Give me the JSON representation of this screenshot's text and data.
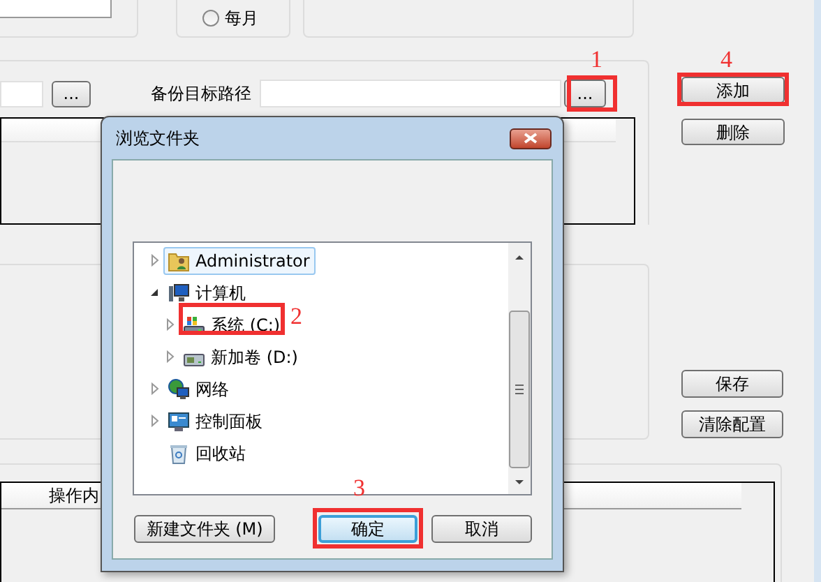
{
  "background": {
    "frequency_option": {
      "label": "每月",
      "selected": false
    },
    "source_browse_button": "...",
    "target_path": {
      "label": "备份目标路径"
    },
    "target_browse_button": "...",
    "side_buttons": [
      "添加",
      "删除",
      "保存",
      "清除配置"
    ],
    "log_table": {
      "columns": [
        "操作内"
      ]
    }
  },
  "dialog": {
    "title": "浏览文件夹",
    "tree": [
      {
        "label": "Administrator",
        "kind": "user-folder",
        "expandable": true,
        "expanded": false,
        "selected": true
      },
      {
        "label": "计算机",
        "kind": "computer",
        "expandable": true,
        "expanded": true,
        "selected": false,
        "children": [
          {
            "label": "系统 (C:)",
            "kind": "system-drive",
            "expandable": true,
            "expanded": false,
            "selected": false
          },
          {
            "label": "新加卷 (D:)",
            "kind": "drive",
            "expandable": true,
            "expanded": false,
            "selected": false
          }
        ]
      },
      {
        "label": "网络",
        "kind": "network",
        "expandable": true,
        "expanded": false,
        "selected": false
      },
      {
        "label": "控制面板",
        "kind": "control-panel",
        "expandable": true,
        "expanded": false,
        "selected": false
      },
      {
        "label": "回收站",
        "kind": "recycle-bin",
        "expandable": false,
        "selected": false
      }
    ],
    "buttons": [
      {
        "label": "新建文件夹 (M)",
        "default": false
      },
      {
        "label": "确定",
        "default": true
      },
      {
        "label": "取消",
        "default": false
      }
    ]
  },
  "callouts": [
    {
      "label": "1"
    },
    {
      "label": "2"
    },
    {
      "label": "3"
    },
    {
      "label": "4"
    }
  ]
}
